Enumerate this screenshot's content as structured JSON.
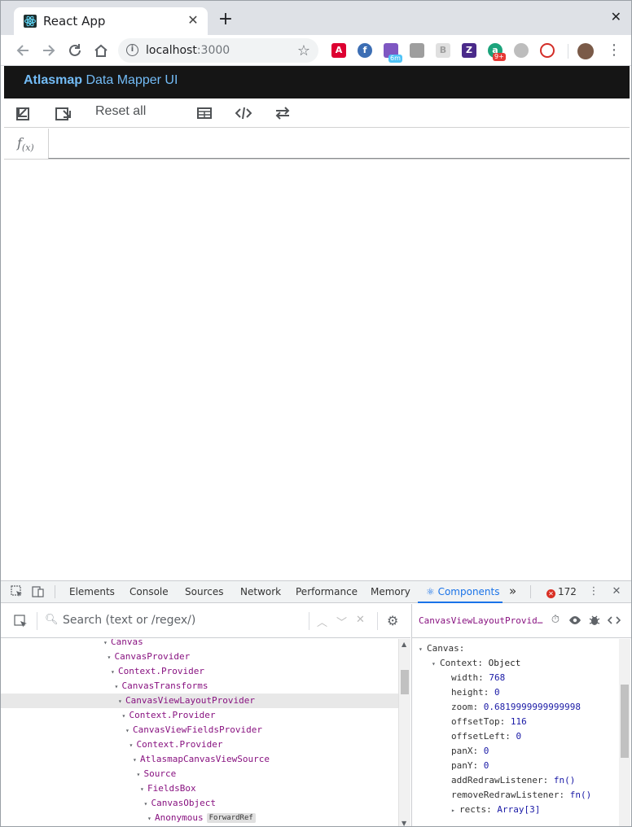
{
  "browser": {
    "tab_title": "React App",
    "tab_close": "✕",
    "new_tab": "+",
    "window_close": "✕",
    "url_host": "localhost",
    "url_port": ":3000",
    "extensions": [
      {
        "name": "angular-icon",
        "color": "#dd0031",
        "glyph": "A"
      },
      {
        "name": "fedora-icon",
        "color": "#3c6eb4",
        "glyph": "f"
      },
      {
        "name": "calendar-icon",
        "color": "#7e57c2",
        "glyph": ""
      },
      {
        "name": "grey-ext-icon",
        "color": "#9e9e9e",
        "glyph": ""
      },
      {
        "name": "b-ext-icon",
        "color": "#d7d7d7",
        "glyph": "B"
      },
      {
        "name": "zotero-icon",
        "color": "#4a2a8a",
        "glyph": "Z"
      },
      {
        "name": "a-ext-icon",
        "color": "#1ba37b",
        "glyph": "a"
      },
      {
        "name": "chat-bubble-icon",
        "color": "#9e9e9e",
        "glyph": ""
      },
      {
        "name": "lastpass-icon",
        "color": "#d32d27",
        "glyph": ""
      }
    ],
    "badge_6m": "6m",
    "badge_9plus": "9+"
  },
  "app": {
    "brand_bold": "Atlasmap",
    "brand_rest": " Data Mapper UI",
    "reset_all": "Reset all",
    "fx_label": "f",
    "fx_sub": "(x)"
  },
  "devtools": {
    "tabs": [
      "Elements",
      "Console",
      "Sources",
      "Network",
      "Performance",
      "Memory"
    ],
    "active_tab": "⚛ Components",
    "more": "»",
    "error_count": "172",
    "search_placeholder": "Search (text or /regex/)",
    "tree": [
      {
        "label": "Canvas",
        "indent": 0,
        "arrow": "▾"
      },
      {
        "label": "CanvasProvider",
        "indent": 1,
        "arrow": "▾"
      },
      {
        "label": "Context.Provider",
        "indent": 2,
        "arrow": "▾"
      },
      {
        "label": "CanvasTransforms",
        "indent": 3,
        "arrow": "▾"
      },
      {
        "label": "CanvasViewLayoutProvider",
        "indent": 4,
        "arrow": "▾",
        "selected": true
      },
      {
        "label": "Context.Provider",
        "indent": 5,
        "arrow": "▾"
      },
      {
        "label": "CanvasViewFieldsProvider",
        "indent": 6,
        "arrow": "▾"
      },
      {
        "label": "Context.Provider",
        "indent": 7,
        "arrow": "▾"
      },
      {
        "label": "AtlasmapCanvasViewSource",
        "indent": 8,
        "arrow": "▾"
      },
      {
        "label": "Source",
        "indent": 9,
        "arrow": "▾"
      },
      {
        "label": "FieldsBox",
        "indent": 10,
        "arrow": "▾"
      },
      {
        "label": "CanvasObject",
        "indent": 11,
        "arrow": "▾"
      },
      {
        "label": "Anonymous",
        "indent": 12,
        "arrow": "▾",
        "tag": "ForwardRef"
      }
    ],
    "inspector": {
      "component_name": "CanvasViewLayoutProvid…",
      "props": [
        {
          "key": "Canvas",
          "sep": ":",
          "value": "",
          "indent": 0,
          "arrow": "▾",
          "type": "obj"
        },
        {
          "key": "Context",
          "sep": ":",
          "value": "Object",
          "indent": 1,
          "arrow": "▾",
          "type": "obj"
        },
        {
          "key": "width",
          "sep": ":",
          "value": "768",
          "indent": 2,
          "arrow": "",
          "type": "num"
        },
        {
          "key": "height",
          "sep": ":",
          "value": "0",
          "indent": 2,
          "arrow": "",
          "type": "num"
        },
        {
          "key": "zoom",
          "sep": ":",
          "value": "0.6819999999999998",
          "indent": 2,
          "arrow": "",
          "type": "num"
        },
        {
          "key": "offsetTop",
          "sep": ":",
          "value": "116",
          "indent": 2,
          "arrow": "",
          "type": "num"
        },
        {
          "key": "offsetLeft",
          "sep": ":",
          "value": "0",
          "indent": 2,
          "arrow": "",
          "type": "num"
        },
        {
          "key": "panX",
          "sep": ":",
          "value": "0",
          "indent": 2,
          "arrow": "",
          "type": "num"
        },
        {
          "key": "panY",
          "sep": ":",
          "value": "0",
          "indent": 2,
          "arrow": "",
          "type": "num"
        },
        {
          "key": "addRedrawListener",
          "sep": ":",
          "value": "fn()",
          "indent": 2,
          "arrow": "",
          "type": "fn"
        },
        {
          "key": "removeRedrawListener",
          "sep": ":",
          "value": "fn()",
          "indent": 2,
          "arrow": "",
          "type": "fn"
        },
        {
          "key": "rects",
          "sep": ":",
          "value": "Array[3]",
          "indent": 2,
          "arrow": "▸",
          "type": "fn"
        }
      ]
    }
  },
  "colors": {
    "app_header_bg": "#151515",
    "brand_blue": "#73bcf7",
    "devtools_accent": "#1a73e8",
    "component_purple": "#881280"
  }
}
